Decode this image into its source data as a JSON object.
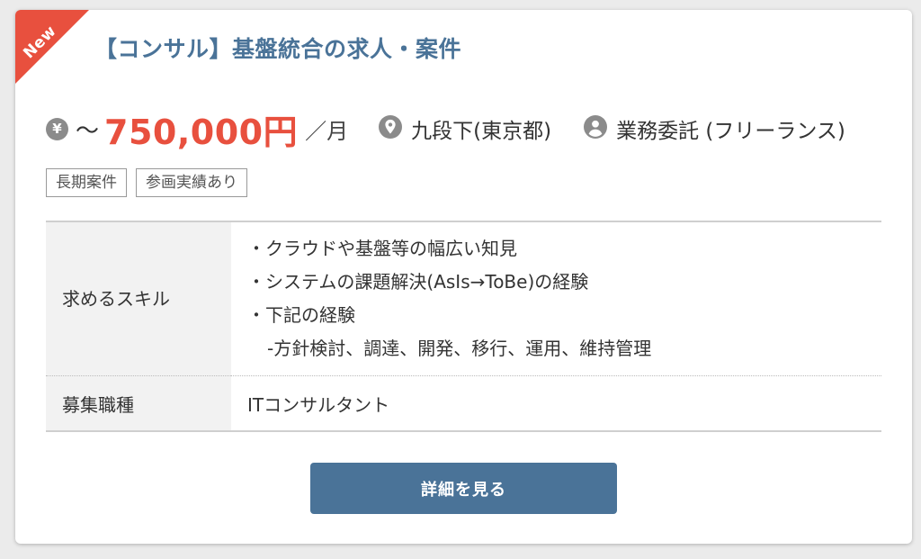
{
  "badge": {
    "label": "New"
  },
  "job": {
    "title": "【コンサル】基盤統合の求人・案件",
    "salary": {
      "currency_icon": "yen-icon",
      "currency_symbol": "¥",
      "prefix": "～",
      "amount": "750,000円",
      "per": "／月"
    },
    "location": {
      "icon": "map-pin-icon",
      "text": "九段下(東京都)"
    },
    "employment": {
      "icon": "person-icon",
      "text": "業務委託 (フリーランス)"
    },
    "tags": [
      "長期案件",
      "参画実績あり"
    ],
    "specs": {
      "skill_label": "求めるスキル",
      "skills": [
        "・クラウドや基盤等の幅広い知見",
        "・システムの課題解決(AsIs→ToBe)の経験",
        "・下記の経験",
        "-方針検討、調達、開発、移行、運用、維持管理"
      ],
      "role_label": "募集職種",
      "role_value": "ITコンサルタント"
    },
    "detail_button": "詳細を見る"
  },
  "colors": {
    "accent": "#4a7398",
    "salary": "#e8503e",
    "badge": "#e8503e",
    "icon_gray": "#8b8b8b"
  }
}
